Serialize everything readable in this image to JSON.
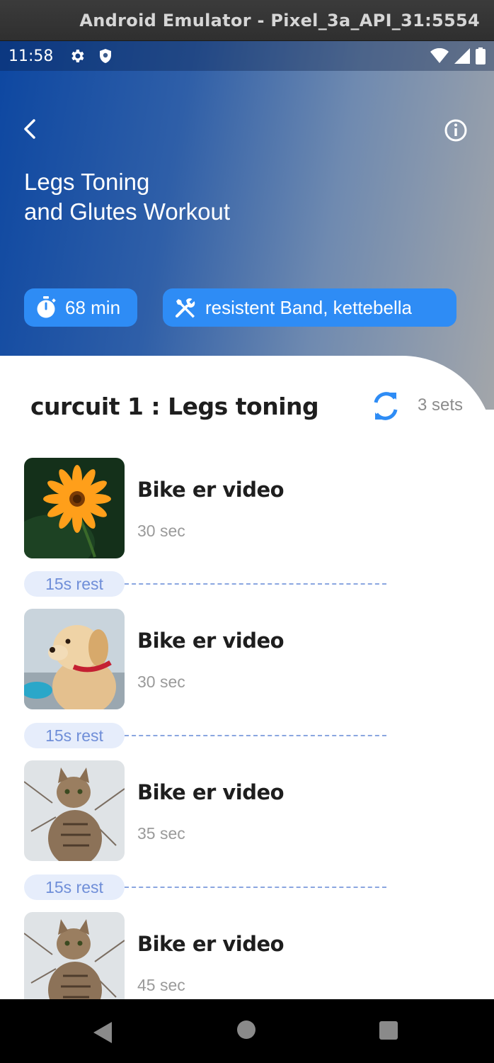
{
  "window": {
    "title": "Android Emulator - Pixel_3a_API_31:5554"
  },
  "status_bar": {
    "time": "11:58"
  },
  "header": {
    "title_line1": "Legs Toning",
    "title_line2": "and Glutes Workout",
    "duration": "68 min",
    "equipment": "resistent Band, kettebella"
  },
  "circuit": {
    "title": "curcuit 1 : Legs toning",
    "sets": "3 sets"
  },
  "exercises": [
    {
      "name": "Bike er video",
      "duration": "30 sec",
      "image": "orange-flower"
    },
    {
      "name": "Bike er video",
      "duration": "30 sec",
      "image": "puppy"
    },
    {
      "name": "Bike er video",
      "duration": "35 sec",
      "image": "tabby-cat"
    },
    {
      "name": "Bike er video",
      "duration": "45 sec",
      "image": "tabby-cat"
    }
  ],
  "rests": [
    "15s rest",
    "15s rest",
    "15s rest"
  ],
  "colors": {
    "accent": "#2e8cf5",
    "hero_start": "#0d47a1",
    "hero_end": "#a3a6aa",
    "rest_pill": "#e6edfb",
    "rest_text": "#6f8ed8"
  },
  "icons": {
    "back": "chevron-left-icon",
    "info": "info-icon",
    "timer": "stopwatch-icon",
    "equipment": "tools-icon",
    "sets": "sync-icon"
  }
}
